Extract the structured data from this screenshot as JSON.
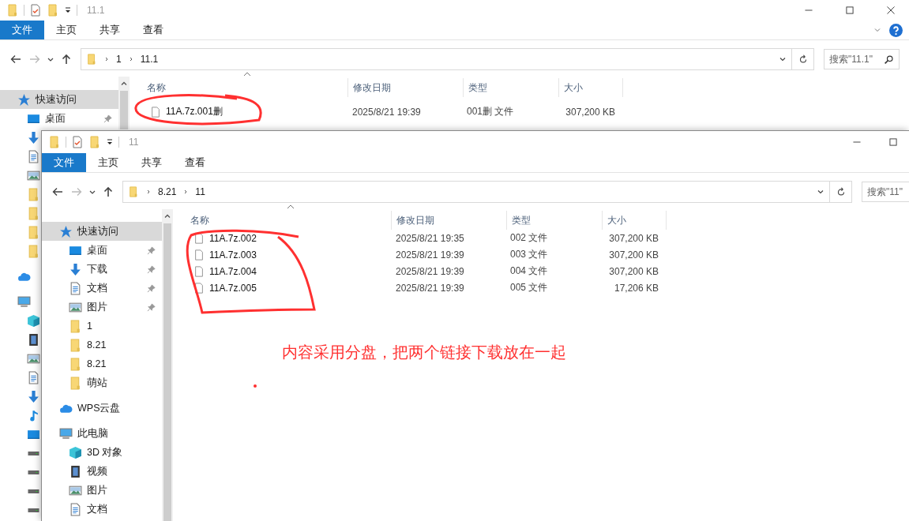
{
  "windows": [
    {
      "title": "11.1",
      "controls": [
        {
          "kind": "minimize"
        },
        {
          "kind": "maximize"
        },
        {
          "kind": "close"
        }
      ],
      "show_help": true,
      "ribbon_tabs": [
        {
          "label": "文件",
          "selected": true
        },
        {
          "label": "主页",
          "selected": false
        },
        {
          "label": "共享",
          "selected": false
        },
        {
          "label": "查看",
          "selected": false
        }
      ],
      "nav_buttons": [
        {
          "kind": "back",
          "disabled": false
        },
        {
          "kind": "forward",
          "disabled": true
        },
        {
          "kind": "recent",
          "disabled": false
        },
        {
          "kind": "up",
          "disabled": false
        }
      ],
      "breadcrumb": [
        "1",
        "11.1"
      ],
      "search": {
        "placeholder": "搜索\"11.1\""
      },
      "nav": [
        {
          "kind": "star",
          "label": "快速访问",
          "selected": true,
          "children": [
            {
              "kind": "desktop",
              "label": "桌面",
              "pinned": true,
              "selected": false
            },
            {
              "kind": "download",
              "selected": false
            },
            {
              "kind": "document",
              "selected": false
            },
            {
              "kind": "picture",
              "selected": false
            },
            {
              "kind": "folder",
              "selected": false
            },
            {
              "kind": "folder",
              "selected": false
            },
            {
              "kind": "folder",
              "selected": false
            },
            {
              "kind": "folder",
              "selected": false
            }
          ]
        },
        {
          "kind": "cloud",
          "selected": false
        },
        {
          "kind": "pc",
          "selected": false,
          "children": [
            {
              "kind": "cube",
              "selected": false
            },
            {
              "kind": "video",
              "selected": false
            },
            {
              "kind": "picture",
              "selected": false
            },
            {
              "kind": "document",
              "selected": false
            },
            {
              "kind": "download",
              "selected": false
            },
            {
              "kind": "music",
              "selected": false
            },
            {
              "kind": "desktop",
              "selected": false
            },
            {
              "kind": "drive",
              "selected": false
            },
            {
              "kind": "drive",
              "selected": false
            },
            {
              "kind": "drive",
              "selected": false
            },
            {
              "kind": "drive",
              "selected": false
            }
          ]
        }
      ],
      "columns": [
        "名称",
        "修改日期",
        "类型",
        "大小"
      ],
      "files": [
        {
          "name": "11A.7z.001删",
          "date": "2025/8/21 19:39",
          "type": "001删 文件",
          "size": "307,200 KB"
        }
      ]
    },
    {
      "title": "11",
      "controls": [
        {
          "kind": "minimize"
        },
        {
          "kind": "maximize"
        }
      ],
      "ribbon_tabs": [
        {
          "label": "文件",
          "selected": true
        },
        {
          "label": "主页",
          "selected": false
        },
        {
          "label": "共享",
          "selected": false
        },
        {
          "label": "查看",
          "selected": false
        }
      ],
      "nav_buttons": [
        {
          "kind": "back",
          "disabled": false
        },
        {
          "kind": "forward",
          "disabled": true
        },
        {
          "kind": "recent",
          "disabled": false
        },
        {
          "kind": "up",
          "disabled": false
        }
      ],
      "breadcrumb": [
        "8.21",
        "11"
      ],
      "search": {
        "placeholder": "搜索\"11\""
      },
      "nav": [
        {
          "kind": "star",
          "label": "快速访问",
          "selected": true,
          "children": [
            {
              "kind": "desktop",
              "label": "桌面",
              "pinned": true,
              "selected": false
            },
            {
              "kind": "download",
              "label": "下载",
              "pinned": true,
              "selected": false
            },
            {
              "kind": "document",
              "label": "文档",
              "pinned": true,
              "selected": false
            },
            {
              "kind": "picture",
              "label": "图片",
              "pinned": true,
              "selected": false
            },
            {
              "kind": "folder",
              "label": "1",
              "selected": false
            },
            {
              "kind": "folder",
              "label": "8.21",
              "selected": false
            },
            {
              "kind": "folder",
              "label": "8.21",
              "selected": false
            },
            {
              "kind": "folder",
              "label": "萌站",
              "selected": false
            }
          ]
        },
        {
          "kind": "cloud",
          "label": "WPS云盘",
          "selected": false
        },
        {
          "kind": "pc",
          "label": "此电脑",
          "selected": false,
          "children": [
            {
              "kind": "cube",
              "label": "3D 对象",
              "selected": false
            },
            {
              "kind": "video",
              "label": "视频",
              "selected": false
            },
            {
              "kind": "picture",
              "label": "图片",
              "selected": false
            },
            {
              "kind": "document",
              "label": "文档",
              "selected": false
            }
          ]
        }
      ],
      "columns": [
        "名称",
        "修改日期",
        "类型",
        "大小"
      ],
      "files": [
        {
          "name": "11A.7z.002",
          "date": "2025/8/21 19:35",
          "type": "002 文件",
          "size": "307,200 KB"
        },
        {
          "name": "11A.7z.003",
          "date": "2025/8/21 19:39",
          "type": "003 文件",
          "size": "307,200 KB"
        },
        {
          "name": "11A.7z.004",
          "date": "2025/8/21 19:39",
          "type": "004 文件",
          "size": "307,200 KB"
        },
        {
          "name": "11A.7z.005",
          "date": "2025/8/21 19:39",
          "type": "005 文件",
          "size": "17,206 KB"
        }
      ]
    }
  ],
  "annotation": {
    "text": "内容采用分盘，把两个链接下载放在一起"
  }
}
